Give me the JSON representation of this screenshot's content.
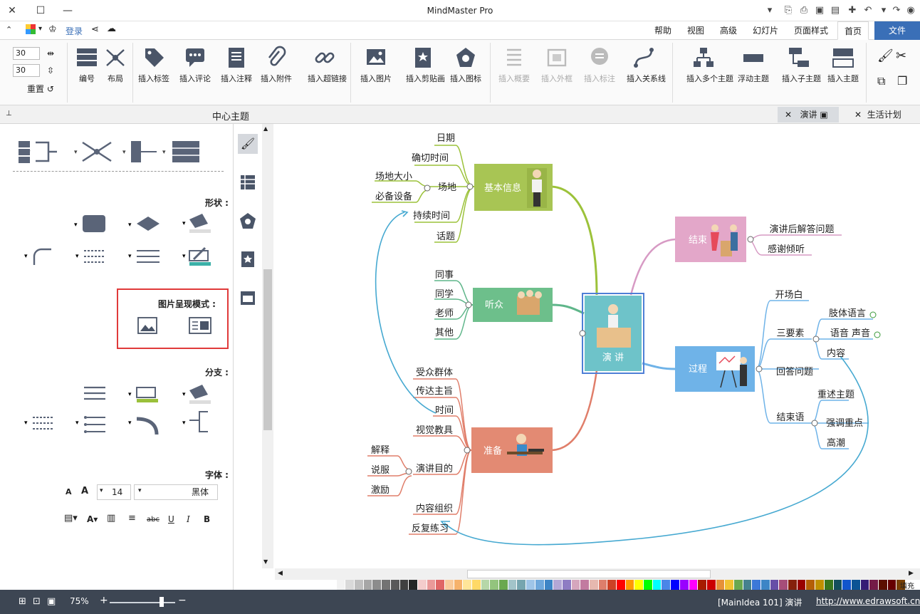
{
  "app": {
    "title": "MindMaster Pro"
  },
  "tabs": [
    "文件",
    "首页",
    "页面样式",
    "幻灯片",
    "高级",
    "视图",
    "帮助"
  ],
  "quick_access": {
    "login": "登录"
  },
  "ribbon": {
    "groups": {
      "topics": [
        "插入主题",
        "插入子主题",
        "浮动主题",
        "插入多个主题"
      ],
      "relation": [
        "插入关系线"
      ],
      "disabled": [
        "插入标注",
        "插入外框",
        "插入概要"
      ],
      "insert": [
        "插入剪贴画",
        "插入图片",
        "插入超链接",
        "插入附件",
        "插入注释",
        "插入评论",
        "插入标签"
      ],
      "layout": [
        "布局",
        "编号"
      ],
      "spin_top": "30",
      "spin_bottom": "30",
      "reset": "重置"
    },
    "icon_labels": {
      "insert_icon": "插入图标"
    }
  },
  "doc_tabs": [
    "生活计划",
    "演讲"
  ],
  "panel": {
    "header": "中心主题",
    "section_shape": "形状 :",
    "section_image_mode": "图片呈现模式 :",
    "section_branch": "分支 :",
    "section_font": "字体 :",
    "font_name": "黑体",
    "font_size": "14"
  },
  "mindmap": {
    "center": "演 讲",
    "topics": [
      {
        "id": "basic",
        "label": "基本信息",
        "color": "#a8c554",
        "children": [
          "日期",
          "确切时间",
          "场地",
          "持续时间",
          "话题"
        ],
        "sub": {
          "场地": [
            "场地大小",
            "必备设备"
          ]
        }
      },
      {
        "id": "audience",
        "label": "听众",
        "color": "#6dbf8b",
        "children": [
          "同事",
          "同学",
          "老师",
          "其他"
        ]
      },
      {
        "id": "prepare",
        "label": "准备",
        "color": "#e38a73",
        "children": [
          "受众群体",
          "传达主旨",
          "时间",
          "视觉教具",
          "演讲目的",
          "内容组织",
          "反复练习"
        ],
        "sub": {
          "演讲目的": [
            "解释",
            "说服",
            "激励"
          ]
        }
      },
      {
        "id": "end",
        "label": "结束",
        "color": "#e3a7c9",
        "children": [
          "演讲后解答问题",
          "感谢倾听"
        ]
      },
      {
        "id": "process",
        "label": "过程",
        "color": "#6fb3e8",
        "children": [
          "开场白",
          "三要素",
          "回答问题",
          "结束语"
        ],
        "sub": {
          "三要素": [
            "肢体语言",
            "语音 声音",
            "内容"
          ],
          "结束语": [
            "重述主题",
            "强调重点",
            "高潮"
          ]
        }
      }
    ]
  },
  "status": {
    "url": "http://www.edrawsoft.cn",
    "doc": "[MainIdea 101] 演讲",
    "zoom": "75%",
    "fill": "填充"
  },
  "colors": {
    "accent": "#3a6fb7",
    "status_bg": "#3d4653",
    "highlight_box": "#e03a3a"
  },
  "palette": [
    "#ffffff",
    "#f2f2f2",
    "#d9d9d9",
    "#bfbfbf",
    "#a6a6a6",
    "#8c8c8c",
    "#737373",
    "#595959",
    "#404040",
    "#262626",
    "#f4cccc",
    "#ea9999",
    "#e06666",
    "#f9cb9c",
    "#f6b26b",
    "#ffe599",
    "#ffd966",
    "#b6d7a8",
    "#93c47d",
    "#6aa84f",
    "#a2c4c9",
    "#76a5af",
    "#9fc5e8",
    "#6fa8dc",
    "#3d85c6",
    "#b4a7d6",
    "#8e7cc3",
    "#d5a6bd",
    "#c27ba0",
    "#e6b8af",
    "#dd7e6b",
    "#cc4125",
    "#ff0000",
    "#ff9900",
    "#ffff00",
    "#00ff00",
    "#00ffff",
    "#4a86e8",
    "#0000ff",
    "#9900ff",
    "#ff00ff",
    "#a61c00",
    "#cc0000",
    "#e69138",
    "#f1c232",
    "#6aa84f",
    "#45818e",
    "#3c78d8",
    "#3d85c6",
    "#674ea7",
    "#a64d79",
    "#85200c",
    "#990000",
    "#b45f06",
    "#bf9000",
    "#38761d",
    "#134f5c",
    "#1155cc",
    "#0b5394",
    "#351c75",
    "#741b47",
    "#5b0f00",
    "#660000",
    "#783f04"
  ]
}
